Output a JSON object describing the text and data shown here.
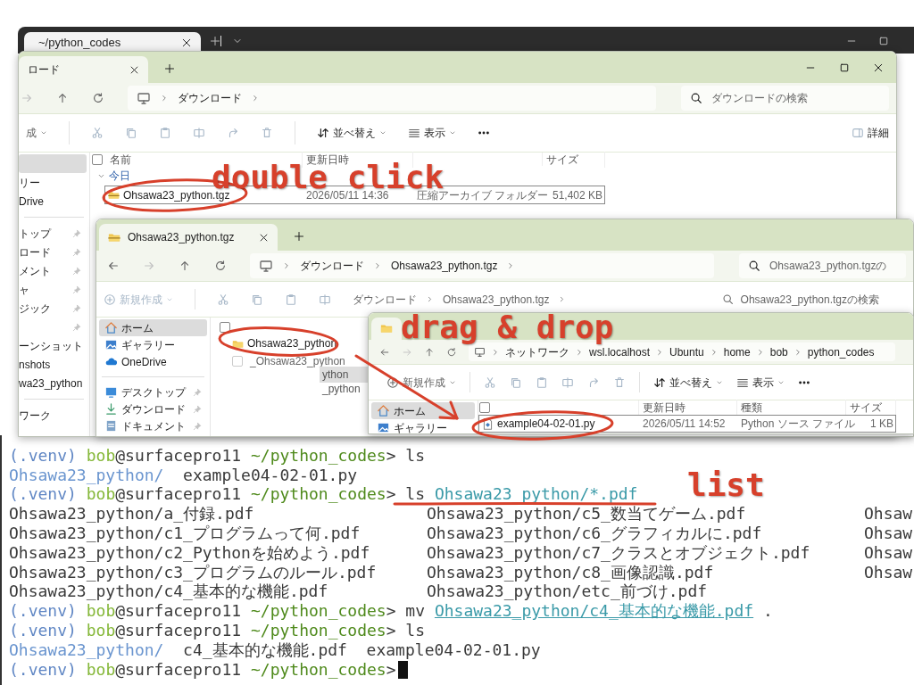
{
  "terminal": {
    "tab_title": "~/python_codes",
    "lines": [
      {
        "kind": "prompt",
        "venv": "(.venv)",
        "user": "bob",
        "host": "@surfacepro11",
        "path": "~/python_codes",
        "symbol": ">",
        "command": "ls",
        "cursor": false
      },
      {
        "kind": "listing",
        "dir": "Ohsawa23_python/",
        "entries": [
          "example04-02-01.py"
        ]
      },
      {
        "kind": "prompt",
        "venv": "(.venv)",
        "user": "bob",
        "host": "@surfacepro11",
        "path": "~/python_codes",
        "symbol": ">",
        "command": "ls",
        "argument": "Ohsawa23_python/*.pdf",
        "underlined": false,
        "cursor": false
      },
      {
        "kind": "columns",
        "cells": [
          "Ohsawa23_python/a_付録.pdf",
          "Ohsawa23_python/c5_数当てゲーム.pdf",
          "Ohsaw"
        ]
      },
      {
        "kind": "columns",
        "cells": [
          "Ohsawa23_python/c1_プログラムって何.pdf",
          "Ohsawa23_python/c6_グラフィカルに.pdf",
          "Ohsaw"
        ]
      },
      {
        "kind": "columns",
        "cells": [
          "Ohsawa23_python/c2_Pythonを始めよう.pdf",
          "Ohsawa23_python/c7_クラスとオブジェクト.pdf",
          "Ohsaw"
        ]
      },
      {
        "kind": "columns",
        "cells": [
          "Ohsawa23_python/c3_プログラムのルール.pdf",
          "Ohsawa23_python/c8_画像認識.pdf",
          "Ohsaw"
        ]
      },
      {
        "kind": "columns",
        "cells": [
          "Ohsawa23_python/c4_基本的な機能.pdf",
          "Ohsawa23_python/etc_前づけ.pdf"
        ]
      },
      {
        "kind": "prompt",
        "venv": "(.venv)",
        "user": "bob",
        "host": "@surfacepro11",
        "path": "~/python_codes",
        "symbol": ">",
        "command": "mv",
        "argument": "Ohsawa23_python/c4_基本的な機能.pdf",
        "underlined": true,
        "tail": ".",
        "cursor": false
      },
      {
        "kind": "prompt",
        "venv": "(.venv)",
        "user": "bob",
        "host": "@surfacepro11",
        "path": "~/python_codes",
        "symbol": ">",
        "command": "ls",
        "cursor": false
      },
      {
        "kind": "listing",
        "dir": "Ohsawa23_python/",
        "entries": [
          "c4_基本的な機能.pdf",
          "example04-02-01.py"
        ]
      },
      {
        "kind": "prompt",
        "venv": "(.venv)",
        "user": "bob",
        "host": "@surfacepro11",
        "path": "~/python_codes",
        "symbol": ">",
        "cursor": true
      }
    ]
  },
  "explorer_windows": [
    {
      "tab_title": "ロード",
      "address": [
        "ダウンロード"
      ],
      "search_placeholder": "ダウンロードの検索",
      "toolbar": {
        "new_label": "成",
        "sort_label": "並べ替え",
        "view_label": "表示",
        "details_label": "詳細"
      },
      "sidebar": [
        {
          "kind": "plain",
          "selected": true,
          "pinned": false
        },
        {
          "kind": "plain",
          "label": "リー",
          "selected": false,
          "pinned": false
        },
        {
          "kind": "plain",
          "label": "Drive",
          "selected": false,
          "pinned": false
        },
        {
          "kind": "divider"
        },
        {
          "kind": "plain",
          "label": "トップ",
          "selected": false,
          "pinned": true
        },
        {
          "kind": "plain",
          "label": "ロード",
          "selected": false,
          "pinned": true
        },
        {
          "kind": "plain",
          "label": "メント",
          "selected": false,
          "pinned": true
        },
        {
          "kind": "plain",
          "label": "ャ",
          "selected": false,
          "pinned": true
        },
        {
          "kind": "plain",
          "label": "ジック",
          "selected": false,
          "pinned": true
        },
        {
          "kind": "plain",
          "selected": false,
          "pinned": true
        },
        {
          "kind": "plain",
          "label": "ーンショット",
          "selected": false,
          "pinned": false
        },
        {
          "kind": "plain",
          "label": "nshots",
          "selected": false,
          "pinned": false
        },
        {
          "kind": "plain",
          "label": "wa23_python",
          "selected": false,
          "pinned": false
        },
        {
          "kind": "divider"
        },
        {
          "kind": "plain",
          "label": "ワーク",
          "selected": false,
          "pinned": false
        }
      ],
      "select_all_checked": false,
      "columns": [
        {
          "label": "名前"
        },
        {
          "label": "更新日時"
        },
        {},
        {
          "label": "サイズ"
        }
      ],
      "group": {
        "label": "今日",
        "expanded": true
      },
      "files": [
        {
          "kind": "archive",
          "name": "Ohsawa23_python.tgz",
          "date": "2026/05/11 14:36",
          "type": "圧縮アーカイブ フォルダー",
          "size": "51,402 KB",
          "selected": true
        }
      ]
    },
    {
      "tab_title": "Ohsawa23_python.tgz",
      "address": [
        "ダウンロード",
        "Ohsawa23_python.tgz"
      ],
      "search_placeholder": "Ohsawa23_python.tgzの",
      "toolbar": {
        "new_label": "新規作成"
      },
      "ghost_address": [
        "ダウンロード",
        "Ohsawa23_python.tgz"
      ],
      "ghost_search": "Ohsawa23_python.tgzの検索",
      "ghost_items": [
        "ython",
        "_python"
      ],
      "sidebar": [
        {
          "kind": "home",
          "label": "ホーム",
          "selected": true,
          "pinned": false
        },
        {
          "kind": "gallery",
          "label": "ギャラリー",
          "selected": false,
          "pinned": false
        },
        {
          "kind": "cloud",
          "label": "OneDrive",
          "selected": false,
          "pinned": false
        },
        {
          "kind": "divider"
        },
        {
          "kind": "desktop",
          "label": "デスクトップ",
          "selected": false,
          "pinned": true
        },
        {
          "kind": "download",
          "label": "ダウンロード",
          "selected": false,
          "pinned": true
        },
        {
          "kind": "document",
          "label": "ドキュメント",
          "selected": false,
          "pinned": true
        }
      ],
      "select_all_checked": false,
      "files": [
        {
          "kind": "folder",
          "name": "Ohsawa23_python",
          "selected": false
        },
        {
          "kind": "ghost",
          "name": "_Ohsawa23_python",
          "selected": false
        }
      ]
    },
    {
      "address": [
        "ネットワーク",
        "wsl.localhost",
        "Ubuntu",
        "home",
        "bob",
        "python_codes"
      ],
      "toolbar": {
        "new_label": "新規作成",
        "sort_label": "並べ替え",
        "view_label": "表示"
      },
      "sidebar": [
        {
          "kind": "home",
          "label": "ホーム",
          "selected": true,
          "pinned": false
        },
        {
          "kind": "gallery",
          "label": "ギャラリー",
          "selected": false,
          "pinned": false
        }
      ],
      "select_all_checked": false,
      "columns": [
        {},
        {
          "label": "更新日時"
        },
        {
          "label": "種類"
        },
        {
          "label": "サイズ"
        }
      ],
      "files": [
        {
          "kind": "python",
          "name": "example04-02-01.py",
          "date": "2026/05/11 14:52",
          "type": "Python ソース ファイル",
          "size": "1 KB",
          "selected": true
        }
      ]
    }
  ],
  "annotations": [
    "double click",
    "drag & drop",
    "list"
  ]
}
